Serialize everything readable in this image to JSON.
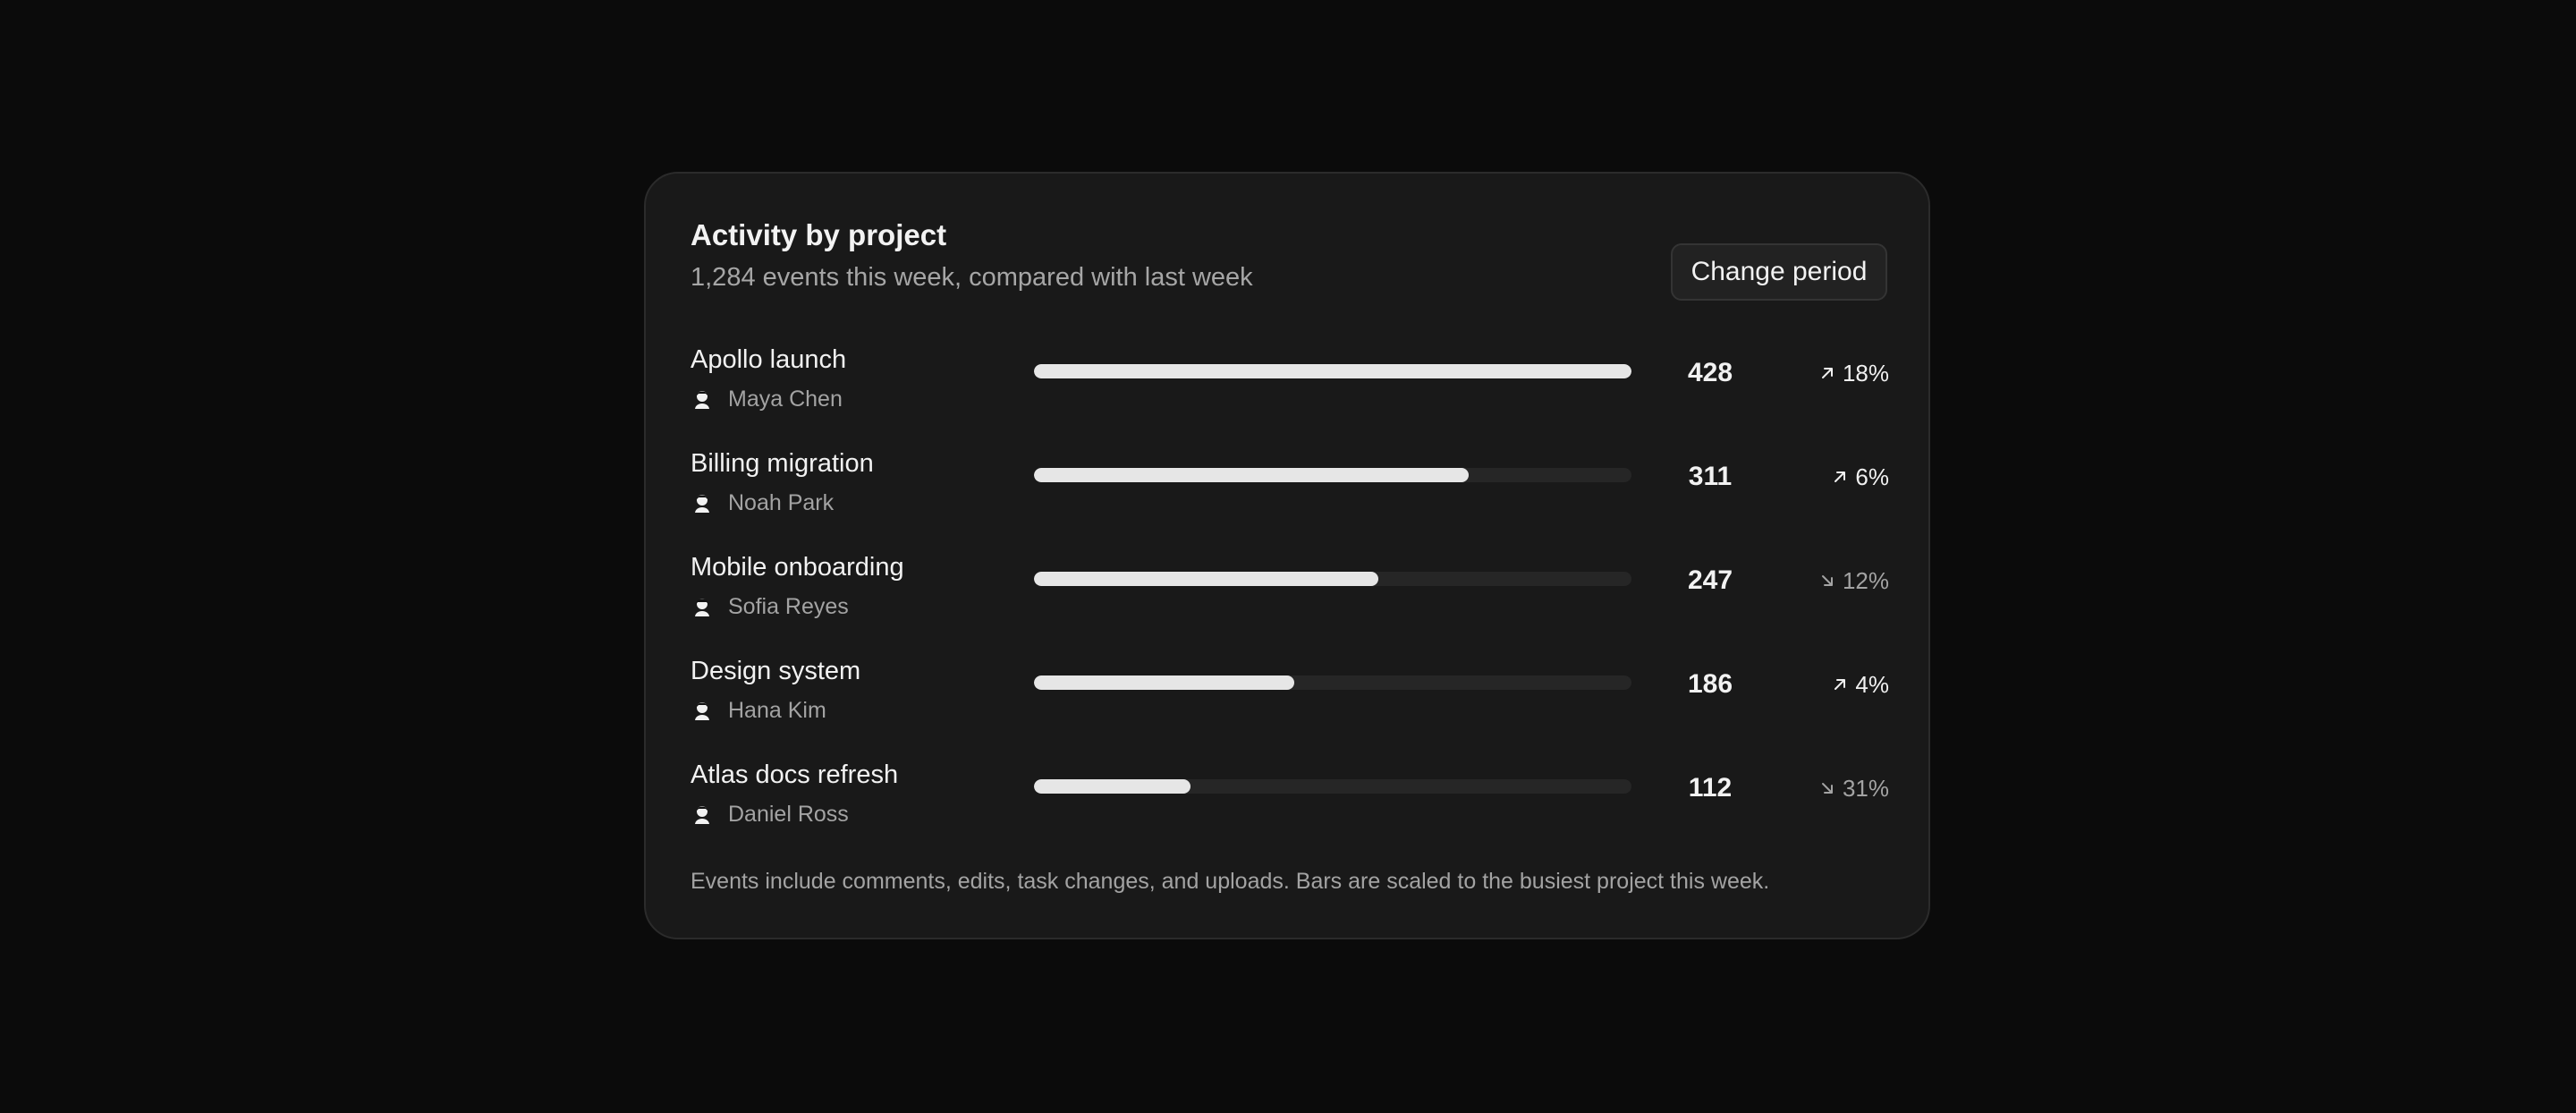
{
  "card": {
    "title": "Activity by project",
    "subtitle": "1,284 events this week, compared with last week",
    "change_period_label": "Change period",
    "footnote": "Events include comments, edits, task changes, and uploads. Bars are scaled to the busiest project this week."
  },
  "projects": [
    {
      "name": "Apollo launch",
      "owner": "Maya Chen",
      "events": "428",
      "bar_fraction": 1.0,
      "delta": "18%",
      "trend": "up"
    },
    {
      "name": "Billing migration",
      "owner": "Noah Park",
      "events": "311",
      "bar_fraction": 0.727,
      "delta": "6%",
      "trend": "up"
    },
    {
      "name": "Mobile onboarding",
      "owner": "Sofia Reyes",
      "events": "247",
      "bar_fraction": 0.577,
      "delta": "12%",
      "trend": "down"
    },
    {
      "name": "Design system",
      "owner": "Hana Kim",
      "events": "186",
      "bar_fraction": 0.435,
      "delta": "4%",
      "trend": "up"
    },
    {
      "name": "Atlas docs refresh",
      "owner": "Daniel Ross",
      "events": "112",
      "bar_fraction": 0.262,
      "delta": "31%",
      "trend": "down"
    }
  ],
  "colors": {
    "bar_fill": "#e6e6e6",
    "bar_track": "#262626",
    "trend_up": "#f0f0f0",
    "trend_down": "#a3a3a3"
  },
  "icons": {
    "avatar": "person-avatar-icon",
    "trend_up": "arrow-up-right-icon",
    "trend_down": "arrow-down-right-icon"
  }
}
